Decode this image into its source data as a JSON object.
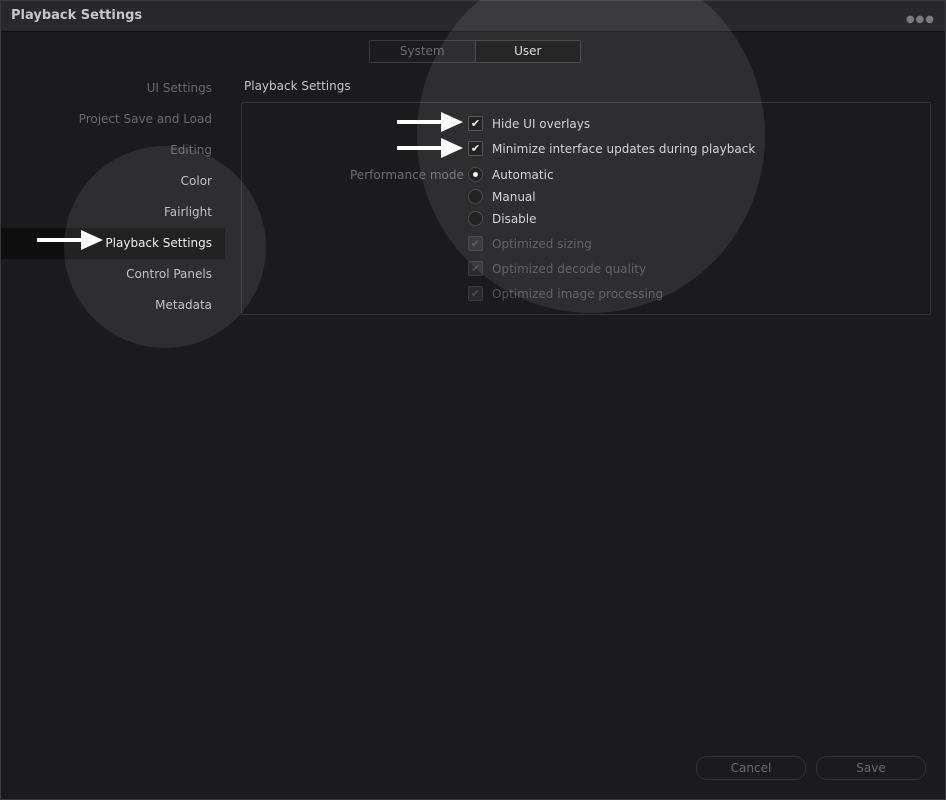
{
  "window": {
    "title": "Playback Settings",
    "menu_icon": "more-icon"
  },
  "tabs": [
    {
      "label": "System",
      "active": false
    },
    {
      "label": "User",
      "active": true
    }
  ],
  "sidebar": {
    "items": [
      {
        "label": "UI Settings"
      },
      {
        "label": "Project Save and Load"
      },
      {
        "label": "Editing"
      },
      {
        "label": "Color"
      },
      {
        "label": "Fairlight"
      },
      {
        "label": "Playback Settings",
        "active": true
      },
      {
        "label": "Control Panels"
      },
      {
        "label": "Metadata"
      }
    ]
  },
  "section": {
    "title": "Playback Settings",
    "hide_ui_overlays": {
      "label": "Hide UI overlays",
      "checked": true
    },
    "minimize_updates": {
      "label": "Minimize interface updates during playback",
      "checked": true
    },
    "performance_mode": {
      "label": "Performance mode",
      "options": [
        {
          "label": "Automatic",
          "selected": true
        },
        {
          "label": "Manual",
          "selected": false
        },
        {
          "label": "Disable",
          "selected": false
        }
      ]
    },
    "optimized_sizing": {
      "label": "Optimized sizing",
      "checked": true,
      "disabled": true
    },
    "optimized_decode": {
      "label": "Optimized decode quality",
      "checked": true,
      "disabled": true
    },
    "optimized_image": {
      "label": "Optimized image processing",
      "checked": true,
      "disabled": true
    }
  },
  "footer": {
    "cancel_label": "Cancel",
    "save_label": "Save"
  },
  "colors": {
    "background": "#1b1b1d",
    "titlebar": "#29292b",
    "active_item": "#0e0e0f",
    "text": "#d0d0d2"
  }
}
